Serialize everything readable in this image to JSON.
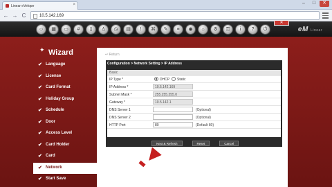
{
  "browser": {
    "tab_title": "Linear eVelope",
    "url": "10.5.142.169",
    "nav": {
      "back": "←",
      "forward": "→",
      "reload": "C"
    },
    "window_buttons": [
      "–",
      "□",
      "✕"
    ],
    "tab_close": "×"
  },
  "app": {
    "header_icons": [
      {
        "name": "users-icon",
        "glyph": "☺"
      },
      {
        "name": "grid-icon",
        "glyph": "▦"
      },
      {
        "name": "card-icon",
        "glyph": "▭"
      },
      {
        "name": "keypad-icon",
        "glyph": "#"
      },
      {
        "name": "door-icon",
        "glyph": "▯"
      },
      {
        "name": "person-icon",
        "glyph": "♙"
      },
      {
        "name": "clock-icon",
        "glyph": "◷"
      },
      {
        "name": "schedule-icon",
        "glyph": "▤"
      },
      {
        "name": "alert-icon",
        "glyph": "!"
      },
      {
        "name": "network-icon",
        "glyph": "⌘"
      },
      {
        "name": "tools-icon",
        "glyph": "✎"
      },
      {
        "name": "report-icon",
        "glyph": "≡"
      },
      {
        "name": "camera-icon",
        "glyph": "◉"
      },
      {
        "name": "home-icon",
        "glyph": "⌂"
      },
      {
        "name": "settings-icon",
        "glyph": "⚙"
      },
      {
        "name": "lock-icon",
        "glyph": "⚿"
      },
      {
        "name": "info-icon",
        "glyph": "i"
      },
      {
        "name": "help-icon",
        "glyph": "?"
      },
      {
        "name": "logout-icon",
        "glyph": "⏻"
      }
    ],
    "brand": "eM",
    "brand_sub": "Linear",
    "close_label": "✕",
    "accent": "#7a1a18"
  },
  "wizard": {
    "title": "Wizard",
    "steps": [
      {
        "label": "Language",
        "active": false
      },
      {
        "label": "License",
        "active": false
      },
      {
        "label": "Card Format",
        "active": false
      },
      {
        "label": "Holiday Group",
        "active": false
      },
      {
        "label": "Schedule",
        "active": false
      },
      {
        "label": "Door",
        "active": false
      },
      {
        "label": "Access Level",
        "active": false
      },
      {
        "label": "Card Holder",
        "active": false
      },
      {
        "label": "Card",
        "active": false
      },
      {
        "label": "Network",
        "active": true
      },
      {
        "label": "Start Save",
        "active": false
      }
    ]
  },
  "main": {
    "back_label": "Return",
    "breadcrumb": "Configuration > Network Setting > IP Address",
    "section_title": "Basic",
    "fields": {
      "ip_type_label": "IP Type *",
      "ip_type_dhcp": "DHCP",
      "ip_type_static": "Static",
      "ip_label": "IP Address *",
      "ip_value": "10.5.142.169",
      "mask_label": "Subnet Mask *",
      "mask_value": "255.255.255.0",
      "gateway_label": "Gateway *",
      "gateway_value": "10.5.142.1",
      "dns1_label": "DNS Server 1",
      "dns1_value": "",
      "dns1_hint": "(Optional)",
      "dns2_label": "DNS Server 2",
      "dns2_value": "",
      "dns2_hint": "(Optional)",
      "http_label": "HTTP Port",
      "http_value": "80",
      "http_hint": "(Default 80)"
    },
    "buttons": {
      "next": "Next & Refresh",
      "reset": "Reset",
      "cancel": "Cancel"
    }
  }
}
